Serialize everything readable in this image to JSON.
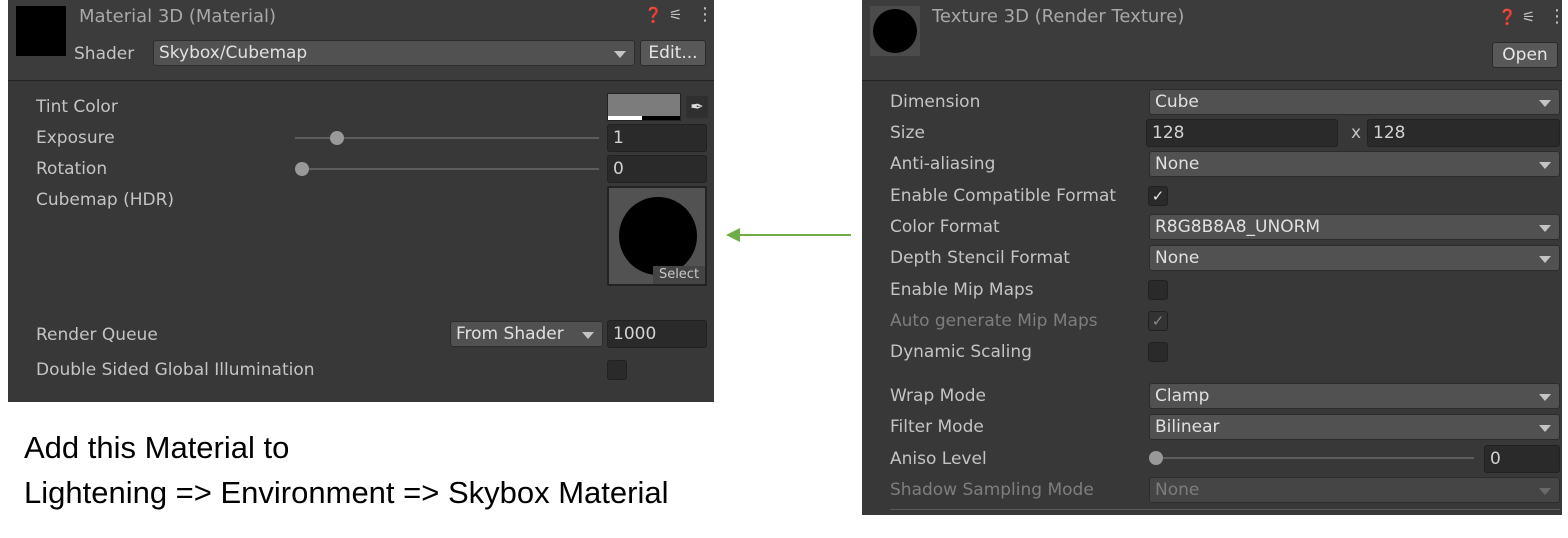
{
  "material_panel": {
    "title": "Material 3D (Material)",
    "shader_label": "Shader",
    "shader_value": "Skybox/Cubemap",
    "edit_button": "Edit...",
    "properties": {
      "tint_color": "Tint Color",
      "exposure_label": "Exposure",
      "exposure_value": "1",
      "exposure_fraction": 0.12,
      "rotation_label": "Rotation",
      "rotation_value": "0",
      "rotation_fraction": 0.0,
      "cubemap_label": "Cubemap   (HDR)",
      "cubemap_select": "Select",
      "render_queue_label": "Render Queue",
      "render_queue_mode": "From Shader",
      "render_queue_value": "1000",
      "double_sided_label": "Double Sided Global Illumination"
    },
    "icons": [
      "help-icon",
      "settings-sliders-icon",
      "more-vert-icon",
      "eyedropper-icon"
    ]
  },
  "texture_panel": {
    "title": "Texture 3D (Render Texture)",
    "open_button": "Open",
    "dimension_label": "Dimension",
    "dimension_value": "Cube",
    "size_label": "Size",
    "size_width": "128",
    "size_x": "x",
    "size_height": "128",
    "anti_aliasing_label": "Anti-aliasing",
    "anti_aliasing_value": "None",
    "compat_format_label": "Enable Compatible Format",
    "compat_format_checked": true,
    "color_format_label": "Color Format",
    "color_format_value": "R8G8B8A8_UNORM",
    "depth_stencil_label": "Depth Stencil Format",
    "depth_stencil_value": "None",
    "mip_maps_label": "Enable Mip Maps",
    "auto_mip_label": "Auto generate Mip Maps",
    "dynamic_scaling_label": "Dynamic Scaling",
    "wrap_mode_label": "Wrap Mode",
    "wrap_mode_value": "Clamp",
    "filter_mode_label": "Filter Mode",
    "filter_mode_value": "Bilinear",
    "aniso_label": "Aniso Level",
    "aniso_value": "0",
    "aniso_fraction": 0.0,
    "shadow_sampling_label": "Shadow Sampling Mode",
    "shadow_sampling_value": "None"
  },
  "caption": {
    "line1": "Add this Material to",
    "line2": "Lightening => Environment => Skybox Material"
  },
  "glyphs": {
    "help": "❓",
    "sliders": "⚟",
    "more": "⋮",
    "eyedropper": "✒",
    "check": "✓",
    "arrow_head": "◀"
  },
  "colors": {
    "panel_bg": "#383838",
    "arrow": "#70ad47"
  }
}
